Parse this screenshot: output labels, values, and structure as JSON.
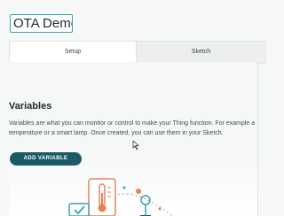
{
  "thing": {
    "name": "OTA Demo"
  },
  "tabs": [
    {
      "label": "Setup",
      "active": true
    },
    {
      "label": "Sketch",
      "active": false
    }
  ],
  "variables": {
    "heading": "Variables",
    "description": "Variables are what you can monitor or control to make your Thing function. For example a temperature or a smart lamp. Once created, you can use them in your Sketch.",
    "add_button_label": "ADD VARIABLE"
  },
  "colors": {
    "accent": "#3ea2a7",
    "button": "#1b5b67",
    "illustration_orange": "#e8825a",
    "illustration_teal": "#3ea2a7"
  },
  "icons": [
    "cursor-icon",
    "thermometer-icon",
    "lamp-icon",
    "checkbox-icon"
  ]
}
